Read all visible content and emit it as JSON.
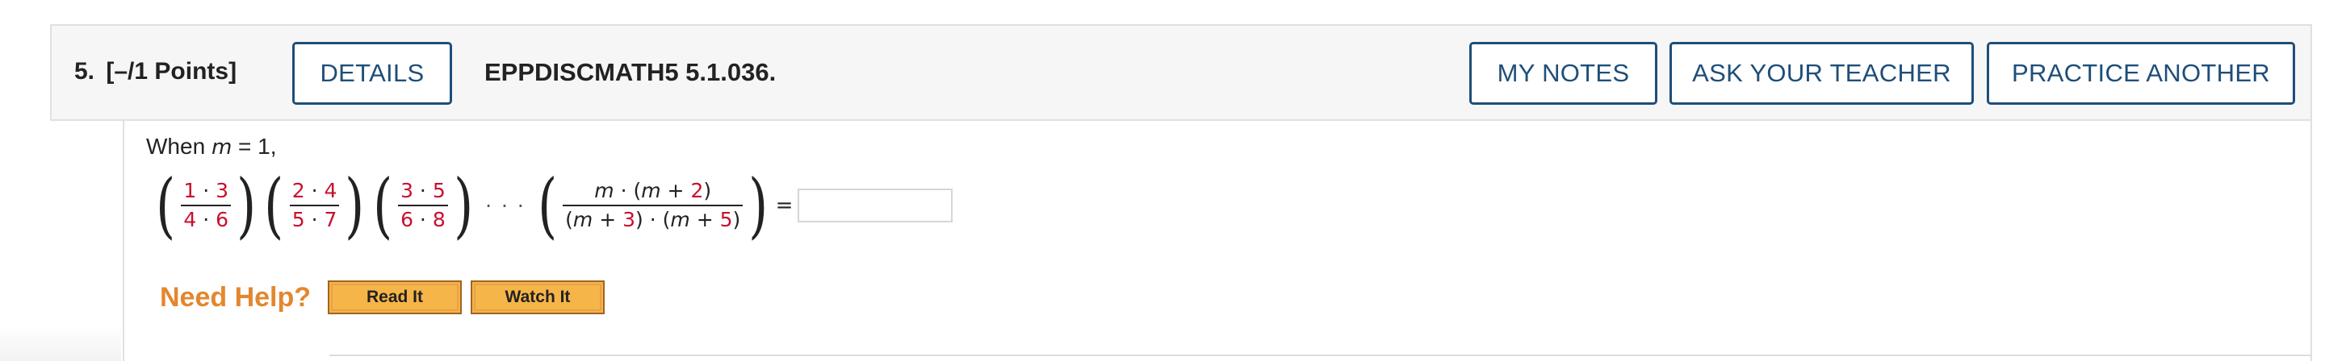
{
  "header": {
    "question_label": "5.",
    "points_label": "[–/1 Points]",
    "details_label": "DETAILS",
    "problem_code": "EPPDISCMATH5 5.1.036.",
    "my_notes_label": "MY NOTES",
    "ask_teacher_label": "ASK YOUR TEACHER",
    "practice_another_label": "PRACTICE ANOTHER"
  },
  "problem": {
    "when_prefix": "When ",
    "var_m": "m",
    "when_suffix": " = 1,",
    "fractions": [
      {
        "num_a": "1",
        "num_b": "3",
        "den_a": "4",
        "den_b": "6"
      },
      {
        "num_a": "2",
        "num_b": "4",
        "den_a": "5",
        "den_b": "7"
      },
      {
        "num_a": "3",
        "num_b": "5",
        "den_a": "6",
        "den_b": "8"
      }
    ],
    "dot": "·",
    "ellipsis": "· · ·",
    "general": {
      "m": "m",
      "plus": " + ",
      "two": "2",
      "three": "3",
      "five": "5"
    },
    "equals": "=",
    "answer_value": ""
  },
  "help": {
    "need_help_label": "Need Help?",
    "read_it_label": "Read It",
    "watch_it_label": "Watch It"
  },
  "colors": {
    "button_border": "#1e4e79",
    "highlight_red": "#c8102e",
    "help_orange": "#e3872f",
    "help_button_fill": "#f6b548"
  }
}
